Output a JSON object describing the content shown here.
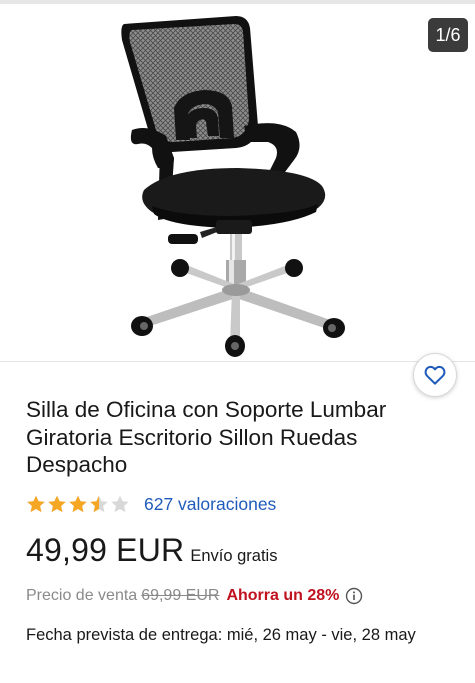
{
  "gallery": {
    "counter": "1/6",
    "image_subject": "office-chair-icon"
  },
  "watch": {
    "icon": "heart-icon"
  },
  "product": {
    "title": "Silla de Oficina con Soporte Lumbar Giratoria Escritorio Sillon Ruedas Despacho",
    "rating": {
      "stars": 3.5,
      "max_stars": 5,
      "count_label": "627 valoraciones"
    },
    "price": "49,99 EUR",
    "shipping": "Envío gratis",
    "list_price_label": "Precio de venta",
    "list_price": "69,99 EUR",
    "savings": "Ahorra un 28%",
    "delivery": "Fecha prevista de entrega: mié, 26 may - vie, 28 may"
  },
  "colors": {
    "star": "#f5a623",
    "star_empty": "#d8d8d8",
    "link": "#1f5bbb",
    "savings": "#c1121f",
    "muted": "#8a8a8a",
    "watch_icon": "#1f5bbb"
  }
}
